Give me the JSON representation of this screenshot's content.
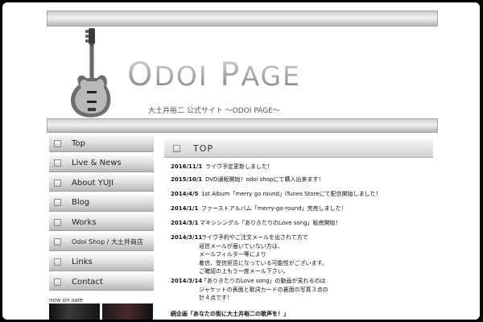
{
  "site": {
    "logo": {
      "part1_big": "O",
      "part1_small": "DOI",
      "part2_big": "P",
      "part2_small": "AGE"
    },
    "subtitle": "大土井裕二 公式サイト 〜ODOI PAGE〜"
  },
  "nav": {
    "items": [
      {
        "label": "Top"
      },
      {
        "label": "Live & News"
      },
      {
        "label": "About YUJI"
      },
      {
        "label": "Blog"
      },
      {
        "label": "Works"
      },
      {
        "label": "Odoi Shop / 大土井商店"
      },
      {
        "label": "Links"
      },
      {
        "label": "Contact"
      }
    ]
  },
  "sidebar": {
    "now_on_sale": "now on sale"
  },
  "content": {
    "title": "TOP",
    "news": [
      {
        "date": "2016/11/1",
        "text": "ライヴ予定更新しました！"
      },
      {
        "date": "2015/10/1",
        "text": "DVD通販開始！odoi shopにて購入出来ます！"
      },
      {
        "date": "2014/4/5",
        "text": "1st Album「merry go round」iTunes Storeにて配信開始しました！"
      },
      {
        "date": "2014/1/1",
        "text": "ファーストアルバム「merry-go-round」完売しました！"
      },
      {
        "date": "2014/3/1",
        "text": "マキシシングル「ありきたりのLove song」販売開始！"
      },
      {
        "date": "2014/3/11",
        "text": "ライヴ予約やご注文メールを出されて方で",
        "cont": [
          "返信メールが届いていない方は、",
          "メールフィルター等により",
          "着信、受信拒否になっている可能性がございます。",
          "ご確認の上もう一度メール下さい。"
        ]
      },
      {
        "date": "2014/3/14",
        "text": "「ありきたりのLove song」の動画が見れるのは",
        "cont": [
          "ジャケットの表面と歌詞カードの裏面の写真３点の",
          "計４点です！"
        ]
      }
    ],
    "feature": "続企画「あなたの街に大土井裕二の歌声を！」"
  }
}
